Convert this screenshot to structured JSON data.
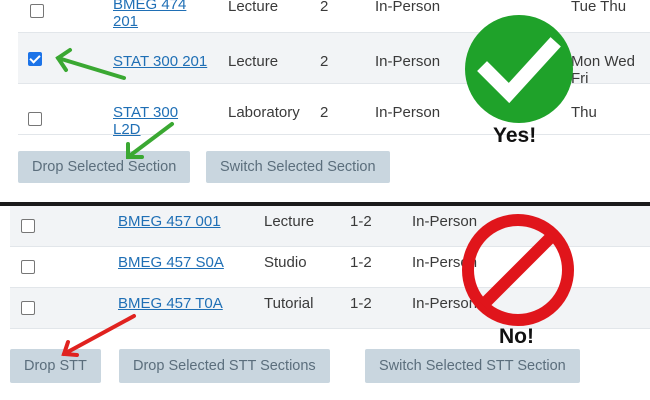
{
  "top_section": {
    "rows": [
      {
        "course": "BMEG 474 201",
        "type": "Lecture",
        "credits": "2",
        "delivery": "In-Person",
        "days": "Tue Thu",
        "checked": false
      },
      {
        "course": "STAT 300 201",
        "type": "Lecture",
        "credits": "2",
        "delivery": "In-Person",
        "days": "Mon Wed Fri",
        "checked": true
      },
      {
        "course": "STAT 300 L2D",
        "type": "Laboratory",
        "credits": "2",
        "delivery": "In-Person",
        "days": "Thu",
        "checked": false
      }
    ],
    "drop_label": "Drop Selected Section",
    "switch_label": "Switch Selected Section",
    "verdict": "Yes!"
  },
  "bottom_section": {
    "rows": [
      {
        "course": "BMEG 457 001",
        "type": "Lecture",
        "credits": "1-2",
        "delivery": "In-Person",
        "checked": false
      },
      {
        "course": "BMEG 457 S0A",
        "type": "Studio",
        "credits": "1-2",
        "delivery": "In-Person",
        "checked": false
      },
      {
        "course": "BMEG 457 T0A",
        "type": "Tutorial",
        "credits": "1-2",
        "delivery": "In-Person",
        "checked": false
      }
    ],
    "drop_stt_label": "Drop STT",
    "drop_selected_label": "Drop Selected STT Sections",
    "switch_label": "Switch Selected STT Section",
    "verdict": "No!"
  },
  "colors": {
    "check_green": "#1fa22a",
    "arrow_green": "#3aa832",
    "no_red": "#e0151b",
    "arrow_red": "#e0221f",
    "link": "#1f6fb5",
    "button_bg": "#c9d6df"
  },
  "icons": {
    "yes": "checkmark-circle-icon",
    "no": "prohibited-icon"
  }
}
